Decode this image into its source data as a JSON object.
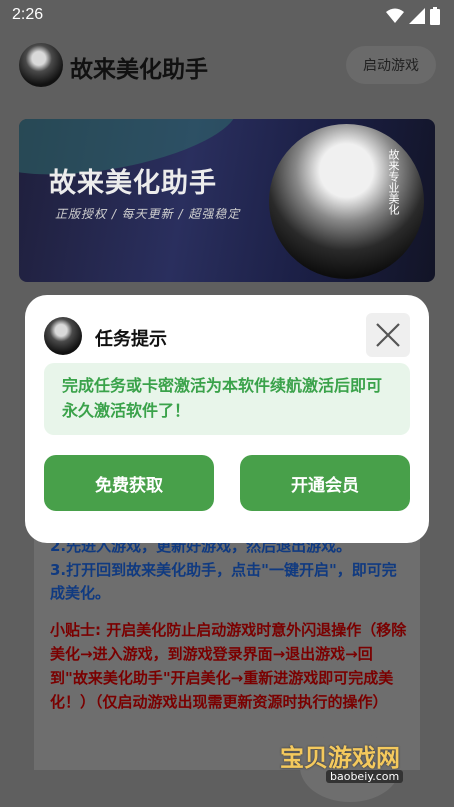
{
  "status": {
    "time": "2:26"
  },
  "header": {
    "title": "故来美化助手",
    "launch_label": "启动游戏"
  },
  "banner": {
    "title": "故来美化助手",
    "subtitle": "正版授权 / 每天更新 / 超强稳定",
    "side_text": "故来",
    "side_text2": "故来专业美化"
  },
  "content": {
    "step2": "2.先进入游戏，更新好游戏，然后退出游戏。",
    "step3": "3.打开回到故来美化助手，点击\"一键开启\"，即可完成美化。",
    "tip": "小贴士: 开启美化防止启动游戏时意外闪退操作（移除美化→进入游戏，到游戏登录界面→退出游戏→回到\"故来美化助手\"开启美化→重新进游戏即可完成美化！）（仅启动游戏出现需更新资源时执行的操作）"
  },
  "modal": {
    "title": "任务提示",
    "message": "完成任务或卡密激活为本软件续航激活后即可永久激活软件了！",
    "free_label": "免费获取",
    "vip_label": "开通会员"
  },
  "watermark": {
    "text": "宝贝游戏网",
    "url": "baobeiy.com"
  },
  "colors": {
    "primary_green": "#48a04a",
    "message_bg": "#e8f5ea",
    "message_text": "#3aa24a",
    "step_blue": "#103a80",
    "tip_red": "#7a0000"
  }
}
